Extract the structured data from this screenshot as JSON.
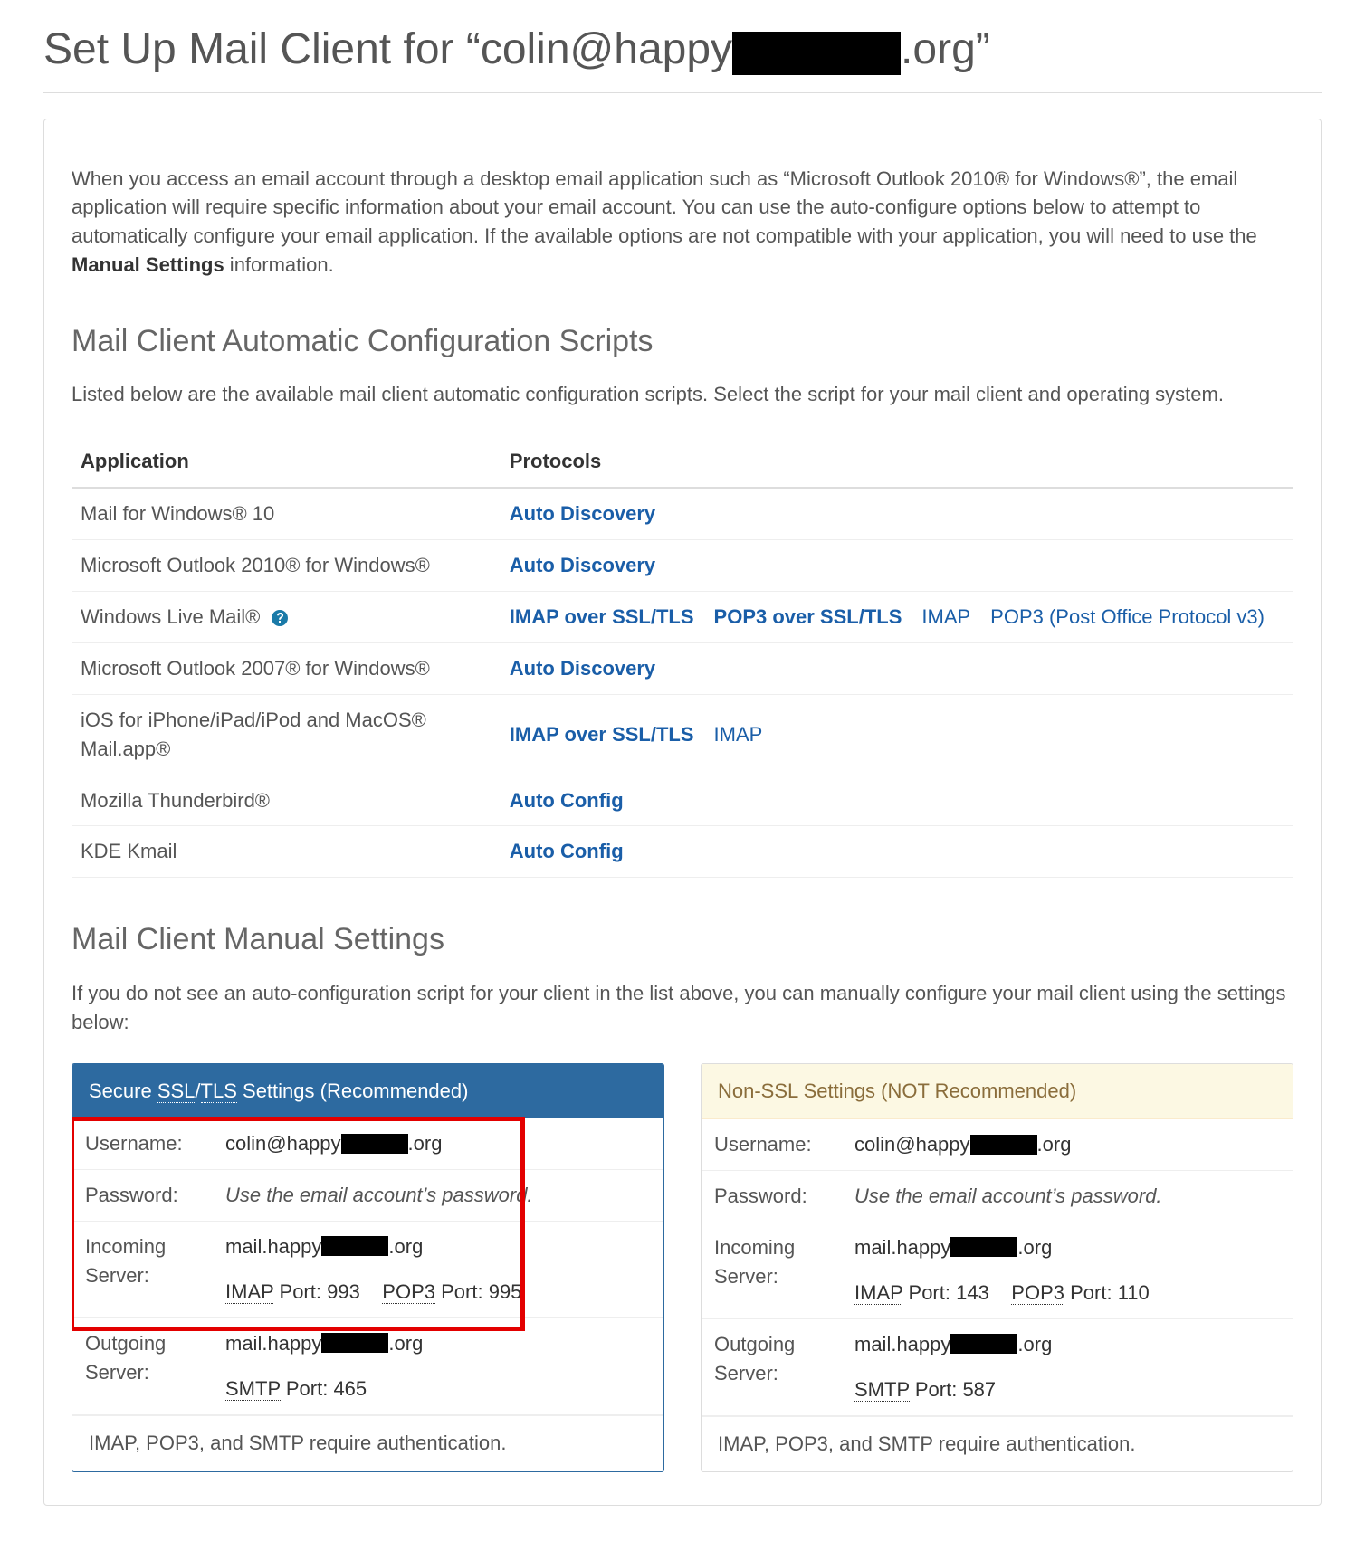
{
  "page_title_prefix": "Set Up Mail Client for “colin@happy",
  "page_title_suffix": ".org”",
  "intro_part1": "When you access an email account through a desktop email application such as “Microsoft Outlook 2010® for Windows®”, the email application will require specific information about your email account. You can use the auto-configure options below to attempt to automatically configure your email application. If the available options are not compatible with your application, you will need to use the ",
  "intro_bold": "Manual Settings",
  "intro_part2": " information.",
  "section_auto_heading": "Mail Client Automatic Configuration Scripts",
  "section_auto_sub": "Listed below are the available mail client automatic configuration scripts. Select the script for your mail client and operating system.",
  "table_headers": {
    "app": "Application",
    "proto": "Protocols"
  },
  "scripts": [
    {
      "app": "Mail for Windows® 10",
      "links": [
        {
          "label": "Auto Discovery",
          "bold": true
        }
      ]
    },
    {
      "app": "Microsoft Outlook 2010® for Windows®",
      "links": [
        {
          "label": "Auto Discovery",
          "bold": true
        }
      ]
    },
    {
      "app": "Windows Live Mail®",
      "help_icon": true,
      "links": [
        {
          "label": "IMAP over SSL/TLS",
          "bold": true
        },
        {
          "label": "POP3 over SSL/TLS",
          "bold": true
        },
        {
          "label": "IMAP",
          "bold": false
        },
        {
          "label": "POP3 (Post Office Protocol v3)",
          "bold": false
        }
      ]
    },
    {
      "app": "Microsoft Outlook 2007® for Windows®",
      "links": [
        {
          "label": "Auto Discovery",
          "bold": true
        }
      ]
    },
    {
      "app": "iOS for iPhone/iPad/iPod and MacOS® Mail.app®",
      "links": [
        {
          "label": "IMAP over SSL/TLS",
          "bold": true
        },
        {
          "label": "IMAP",
          "bold": false
        }
      ]
    },
    {
      "app": "Mozilla Thunderbird®",
      "links": [
        {
          "label": "Auto Config",
          "bold": true
        }
      ]
    },
    {
      "app": "KDE Kmail",
      "links": [
        {
          "label": "Auto Config",
          "bold": true
        }
      ]
    }
  ],
  "section_manual_heading": "Mail Client Manual Settings",
  "section_manual_sub": "If you do not see an auto-configuration script for your client in the list above, you can manually configure your mail client using the settings below:",
  "labels": {
    "username": "Username:",
    "password": "Password:",
    "incoming": "Incoming Server:",
    "outgoing": "Outgoing Server:",
    "password_note": "Use the email account’s password.",
    "imap_label": "IMAP",
    "pop3_label": "POP3",
    "smtp_label": "SMTP",
    "port_word": "Port:",
    "auth_note": "IMAP, POP3, and SMTP require authentication."
  },
  "secure": {
    "header_prefix": "Secure ",
    "header_ssl": "SSL",
    "header_slash": "/",
    "header_tls": "TLS",
    "header_suffix": " Settings (Recommended)",
    "username_prefix": "colin@happy",
    "username_suffix": ".org",
    "server_prefix": "mail.happy",
    "server_suffix": ".org",
    "imap_port": "993",
    "pop3_port": "995",
    "smtp_port": "465"
  },
  "nonsecure": {
    "header": "Non-SSL Settings (NOT Recommended)",
    "username_prefix": "colin@happy",
    "username_suffix": ".org",
    "server_prefix": "mail.happy",
    "server_suffix": ".org",
    "imap_port": "143",
    "pop3_port": "110",
    "smtp_port": "587"
  }
}
